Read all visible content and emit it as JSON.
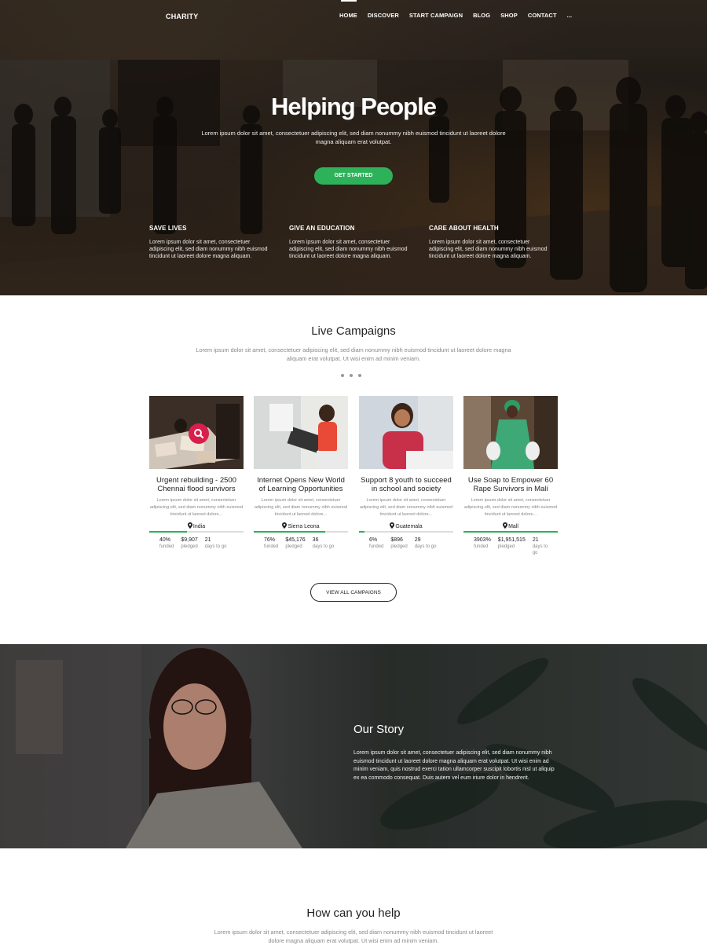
{
  "header": {
    "logo": "CHARITY",
    "nav": [
      "HOME",
      "DISCOVER",
      "START CAMPAIGN",
      "BLOG",
      "SHOP",
      "CONTACT",
      "..."
    ]
  },
  "hero": {
    "title": "Helping People",
    "subtitle": "Lorem ipsum dolor sit amet, consectetuer adipiscing elit, sed diam nonummy nibh euismod tincidunt ut laoreet dolore magna aliquam erat volutpat.",
    "button": "GET STARTED",
    "features": [
      {
        "title": "SAVE LIVES",
        "text": "Lorem ipsum dolor sit amet, consectetuer adipiscing elit, sed diam nonummy nibh euismod tincidunt ut laoreet dolore magna aliquam."
      },
      {
        "title": "GIVE AN EDUCATION",
        "text": "Lorem ipsum dolor sit amet, consectetuer adipiscing elit, sed diam nonummy nibh euismod tincidunt ut laoreet dolore magna aliquam."
      },
      {
        "title": "CARE ABOUT HEALTH",
        "text": "Lorem ipsum dolor sit amet, consectetuer adipiscing elit, sed diam nonummy nibh euismod tincidunt ut laoreet dolore magna aliquam."
      }
    ]
  },
  "campaigns": {
    "title": "Live Campaigns",
    "description": "Lorem ipsum dolor sit amet, consectetuer adipiscing elit, sed diam nonummy nibh euismod tincidunt ut laoreet dolore magna aliquam erat volutpat. Ut wisi enim ad minim veniam.",
    "button": "VIEW ALL CAMPAIGNS",
    "items": [
      {
        "title": "Urgent rebuilding - 2500 Chennai flood survivors",
        "text": "Lorem ipsum dolor sit amet, consectetuer adipiscing elit, sed diam nonummy nibh euismod tincidunt ut laoreet dolore...",
        "location": "India",
        "funded": "40%",
        "funded_label": "funded",
        "pledged": "$9,907",
        "pledged_label": "pledged",
        "days": "21",
        "days_label": "days to go",
        "progress": 0.4
      },
      {
        "title": "Internet Opens New World of Learning Opportunities",
        "text": "Lorem ipsum dolor sit amet, consectetuer adipiscing elit, sed diam nonummy nibh euismod tincidunt ut laoreet dolore...",
        "location": "Sierra Leona",
        "funded": "76%",
        "funded_label": "funded",
        "pledged": "$45,176",
        "pledged_label": "pledged",
        "days": "36",
        "days_label": "days to go",
        "progress": 0.76
      },
      {
        "title": "Support 8 youth to succeed in school and society",
        "text": "Lorem ipsum dolor sit amet, consectetuer adipiscing elit, sed diam nonummy nibh euismod tincidunt ut laoreet dolore...",
        "location": "Guatemala",
        "funded": "6%",
        "funded_label": "funded",
        "pledged": "$896",
        "pledged_label": "pledged",
        "days": "29",
        "days_label": "days to go",
        "progress": 0.06
      },
      {
        "title": "Use Soap to Empower 60 Rape Survivors in Mali",
        "text": "Lorem ipsum dolor sit amet, consectetuer adipiscing elit, sed diam nonummy nibh euismod tincidunt ut laoreet dolore...",
        "location": "Mall",
        "funded": "3903%",
        "funded_label": "funded",
        "pledged": "$1,951,515",
        "pledged_label": "pledged",
        "days": "21",
        "days_label": "days to go",
        "progress": 1.0
      }
    ]
  },
  "story": {
    "title": "Our Story",
    "text": "Lorem ipsum dolor sit amet, consectetuer adipiscing elit, sed diam nonummy nibh euismod tincidunt ut laoreet dolore magna aliquam erat volutpat. Ut wisi enim ad minim veniam, quis nostrud exerci tation ullamcorper suscipit lobortis nisl ut aliquip ex ea commodo consequat. Duis autem vel eum iriure dolor in hendrerit."
  },
  "help": {
    "title": "How can you help",
    "description": "Lorem ipsum dolor sit amet, consectetuer adipiscing elit, sed diam nonummy nibh euismod tincidunt ut laoreet dolore magna aliquam erat volutpat. Ut wisi enim ad minim veniam."
  },
  "colors": {
    "accent": "#2db25a",
    "badge": "#d81f4b",
    "text": "#222222",
    "muted": "#888888"
  }
}
